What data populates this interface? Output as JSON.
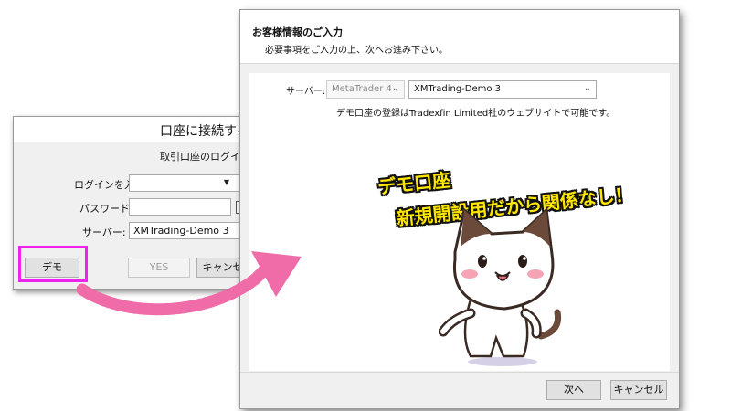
{
  "login_dialog": {
    "title": "口座に接続する",
    "description": "取引口座のログイン情報",
    "login_label": "ログインを入力:",
    "login_value": "",
    "password_label": "パスワード:",
    "password_value": "",
    "server_label": "サーバー:",
    "server_value": "XMTrading-Demo 3",
    "demo_button": "デモ",
    "yes_button": "YES",
    "cancel_button": "キャンセル"
  },
  "account_dialog": {
    "title": "お客様情報のご入力",
    "subtitle": "必要事項をご入力の上、次へお進み下さい。",
    "server_label": "サーバー:",
    "platform_value": "MetaTrader 4",
    "server_value": "XMTrading-Demo 3",
    "registration_note": "デモ口座の登録はTradexfin Limited社のウェブサイトで可能です。",
    "next_button": "次へ",
    "cancel_button": "キャンセル"
  },
  "annotation": {
    "line1": "デモ口座",
    "line2": "新規開設用だから関係なし！"
  },
  "colors": {
    "highlight": "#ee22ee",
    "arrow": "#f06ca8",
    "caption": "#ffe600"
  }
}
